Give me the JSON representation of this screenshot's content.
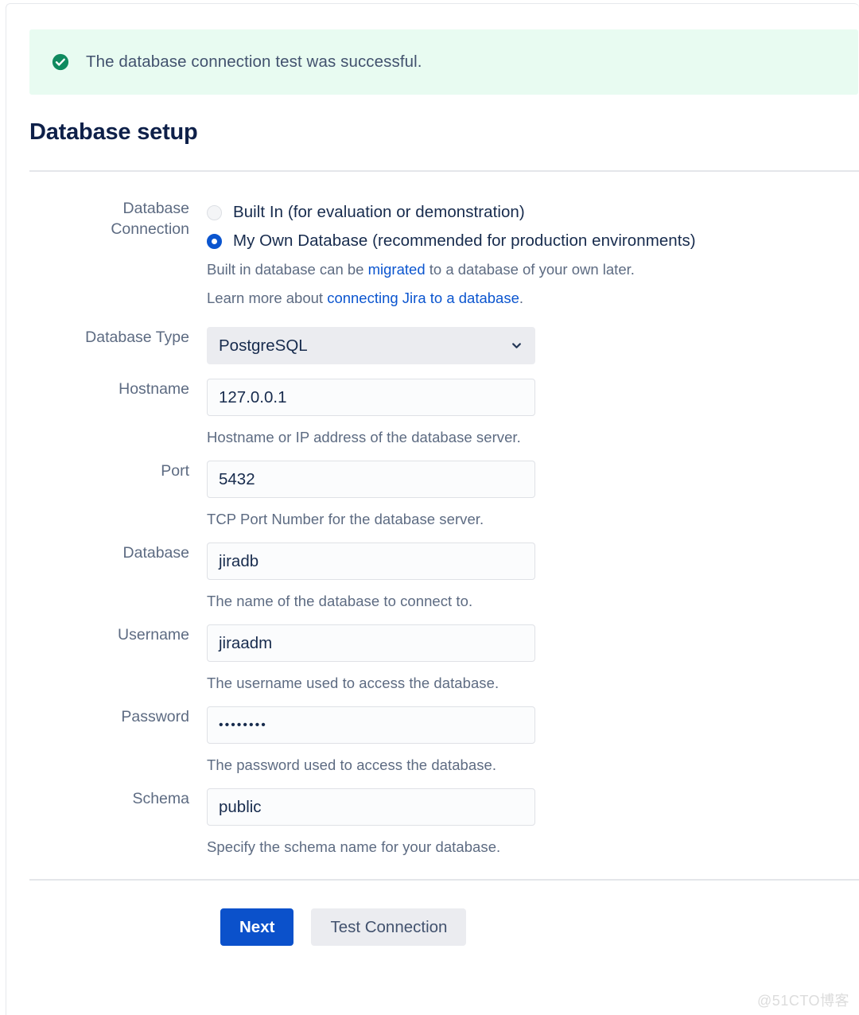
{
  "banner": {
    "icon": "check-circle-icon",
    "message": "The database connection test was successful.",
    "background_color": "#e8fbf1",
    "icon_color": "#0f8a5f"
  },
  "page_title": "Database setup",
  "form": {
    "connection": {
      "label_line1": "Database",
      "label_line2": "Connection",
      "options": [
        {
          "label": "Built In (for evaluation or demonstration)",
          "selected": false
        },
        {
          "label": "My Own Database (recommended for production environments)",
          "selected": true
        }
      ],
      "note1_before": "Built in database can be ",
      "note1_link": "migrated",
      "note1_after": " to a database of your own later.",
      "note2_before": "Learn more about ",
      "note2_link": "connecting Jira to a database",
      "note2_after": "."
    },
    "database_type": {
      "label": "Database Type",
      "value": "PostgreSQL",
      "icon": "chevron-down-icon"
    },
    "hostname": {
      "label": "Hostname",
      "value": "127.0.0.1",
      "hint": "Hostname or IP address of the database server."
    },
    "port": {
      "label": "Port",
      "value": "5432",
      "hint": "TCP Port Number for the database server."
    },
    "database": {
      "label": "Database",
      "value": "jiradb",
      "hint": "The name of the database to connect to."
    },
    "username": {
      "label": "Username",
      "value": "jiraadm",
      "hint": "The username used to access the database."
    },
    "password": {
      "label": "Password",
      "value": "••••••••",
      "hint": "The password used to access the database."
    },
    "schema": {
      "label": "Schema",
      "value": "public",
      "hint": "Specify the schema name for your database."
    }
  },
  "footer": {
    "next_label": "Next",
    "test_connection_label": "Test Connection",
    "primary_color": "#0b51cb"
  },
  "watermark": "@51CTO博客"
}
